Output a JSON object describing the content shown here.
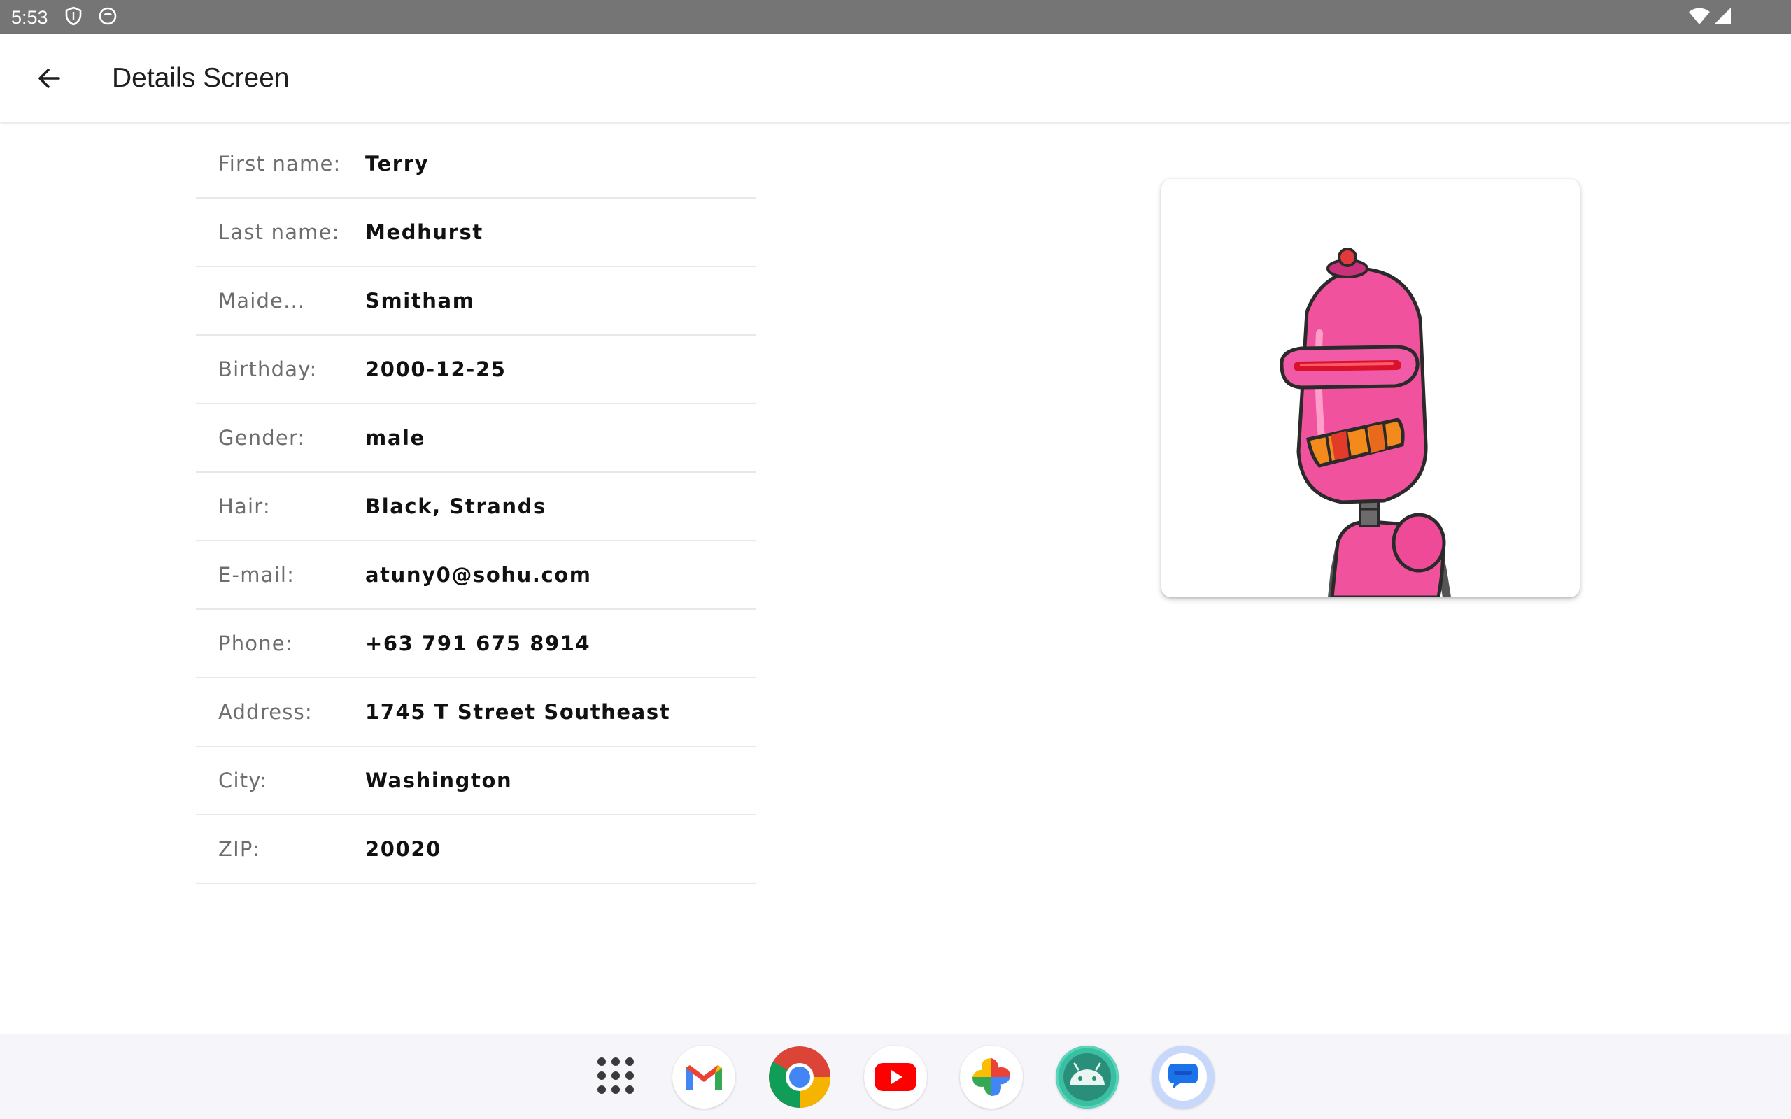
{
  "status_bar": {
    "time": "5:53"
  },
  "app_bar": {
    "title": "Details Screen"
  },
  "details": [
    {
      "label": "First name:",
      "value": "Terry"
    },
    {
      "label": "Last name:",
      "value": "Medhurst"
    },
    {
      "label": "Maide...",
      "value": "Smitham"
    },
    {
      "label": "Birthday:",
      "value": "2000-12-25"
    },
    {
      "label": "Gender:",
      "value": "male"
    },
    {
      "label": "Hair:",
      "value": "Black, Strands"
    },
    {
      "label": "E-mail:",
      "value": "atuny0@sohu.com"
    },
    {
      "label": "Phone:",
      "value": "+63 791 675 8914"
    },
    {
      "label": "Address:",
      "value": "1745 T Street Southeast"
    },
    {
      "label": "City:",
      "value": "Washington"
    },
    {
      "label": "ZIP:",
      "value": "20020"
    }
  ],
  "avatar": {
    "icon": "robot-avatar"
  },
  "dock": {
    "apps": [
      "all-apps",
      "gmail",
      "chrome",
      "youtube",
      "photos",
      "android-studio",
      "messages"
    ]
  },
  "colors": {
    "status_bar": "#757575",
    "label": "#6d6d6d",
    "value": "#111111",
    "divider": "#e8e8e8",
    "robot_body": "#f0529e",
    "dock_bg": "#f6f5fa"
  }
}
